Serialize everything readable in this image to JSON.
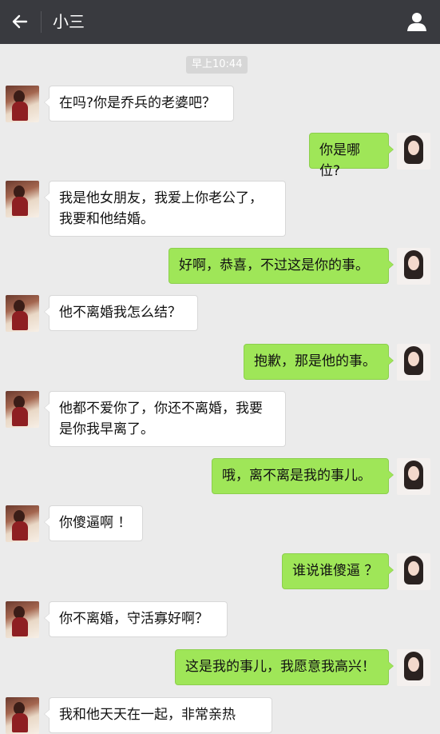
{
  "header": {
    "title": "小三",
    "back_icon": "arrow-left-icon",
    "profile_icon": "person-icon",
    "bar_color": "#393a3f"
  },
  "timestamp": "早上10:44",
  "colors": {
    "sent_bubble": "#9fe658",
    "received_bubble": "#ffffff",
    "background": "#ebebeb"
  },
  "messages": [
    {
      "side": "left",
      "text": "在吗?你是乔兵的老婆吧？"
    },
    {
      "side": "right",
      "text": "你是哪位?"
    },
    {
      "side": "left",
      "text": "我是他女朋友，我爱上你老公了，我要和他结婚。"
    },
    {
      "side": "right",
      "text": "好啊，恭喜，不过这是你的事。"
    },
    {
      "side": "left",
      "text": "他不离婚我怎么结？"
    },
    {
      "side": "right",
      "text": "抱歉，那是他的事。"
    },
    {
      "side": "left",
      "text": "他都不爱你了，你还不离婚，我要是你我早离了。"
    },
    {
      "side": "right",
      "text": "哦，离不离是我的事儿。"
    },
    {
      "side": "left",
      "text": "你傻逼啊 ！"
    },
    {
      "side": "right",
      "text": "谁说谁傻逼 ？"
    },
    {
      "side": "left",
      "text": "你不离婚，守活寡好啊？"
    },
    {
      "side": "right",
      "text": "这是我的事儿，我愿意我高兴！"
    },
    {
      "side": "left",
      "text": "我和他天天在一起，非常亲热"
    }
  ]
}
